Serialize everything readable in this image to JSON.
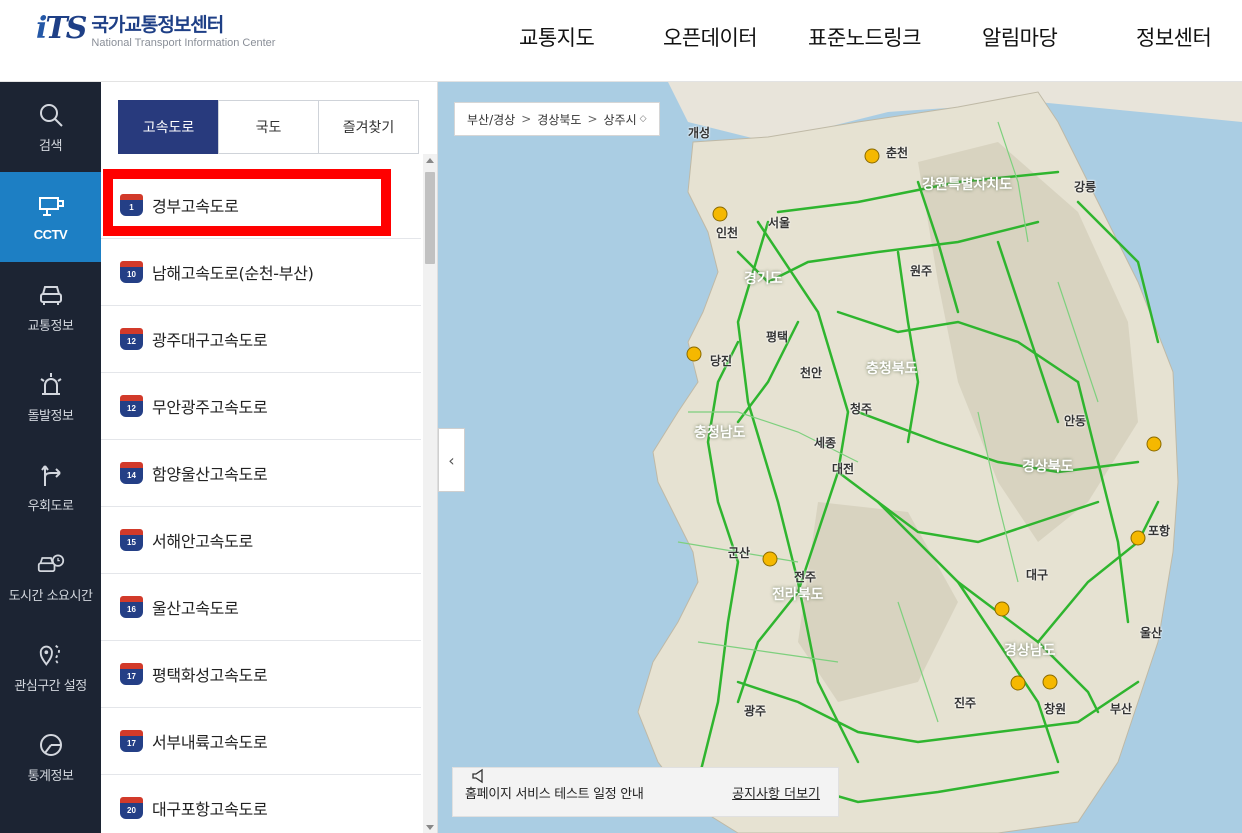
{
  "header": {
    "logo_mark": "iTS",
    "logo_title": "국가교통정보센터",
    "logo_subtitle": "National Transport Information Center",
    "nav": [
      "교통지도",
      "오픈데이터",
      "표준노드링크",
      "알림마당",
      "정보센터"
    ]
  },
  "sidebar": {
    "items": [
      {
        "label": "검색",
        "icon": "search-icon"
      },
      {
        "label": "CCTV",
        "icon": "cctv-icon"
      },
      {
        "label": "교통정보",
        "icon": "car-icon"
      },
      {
        "label": "돌발정보",
        "icon": "alert-light-icon"
      },
      {
        "label": "우회도로",
        "icon": "detour-icon"
      },
      {
        "label": "도시간 소요시간",
        "icon": "car-clock-icon"
      },
      {
        "label": "관심구간 설정",
        "icon": "location-route-icon"
      },
      {
        "label": "통계정보",
        "icon": "statistics-icon"
      }
    ],
    "active_index": 1
  },
  "panel": {
    "tabs": [
      "고속도로",
      "국도",
      "즐겨찾기"
    ],
    "active_tab": 0,
    "roads": [
      {
        "number": "1",
        "name": "경부고속도로"
      },
      {
        "number": "10",
        "name": "남해고속도로(순천-부산)"
      },
      {
        "number": "12",
        "name": "광주대구고속도로"
      },
      {
        "number": "12",
        "name": "무안광주고속도로"
      },
      {
        "number": "14",
        "name": "함양울산고속도로"
      },
      {
        "number": "15",
        "name": "서해안고속도로"
      },
      {
        "number": "16",
        "name": "울산고속도로"
      },
      {
        "number": "17",
        "name": "평택화성고속도로"
      },
      {
        "number": "17",
        "name": "서부내륙고속도로"
      },
      {
        "number": "20",
        "name": "대구포항고속도로"
      }
    ],
    "selected_index": 0
  },
  "map": {
    "breadcrumb": [
      "부산/경상",
      "경상북도",
      "상주시"
    ],
    "breadcrumb_sep": ">",
    "breadcrumb_suffix": "◇",
    "collapse_glyph": "‹",
    "cities": [
      "개성",
      "인천",
      "서울",
      "경기도",
      "평택",
      "당진",
      "천안",
      "청주",
      "세종",
      "대전",
      "충청남도",
      "충청북도",
      "강원특별자치도",
      "전라북도",
      "전주",
      "군산",
      "광주",
      "경상북도",
      "대구",
      "포항",
      "울산",
      "부산",
      "경상남도",
      "창원",
      "진주",
      "강릉",
      "원주",
      "춘천",
      "안동"
    ],
    "notice": {
      "text": "홈페이지 서비스 테스트 일정 안내",
      "link": "공지사항 더보기"
    }
  },
  "colors": {
    "header_bg": "#ffffff",
    "sidebar_bg": "#1c2433",
    "sidebar_active": "#1d7fc4",
    "tab_active": "#283a7d",
    "highlight": "#ff0000",
    "road_green": "#2fb52f",
    "sea": "#aacde3"
  }
}
